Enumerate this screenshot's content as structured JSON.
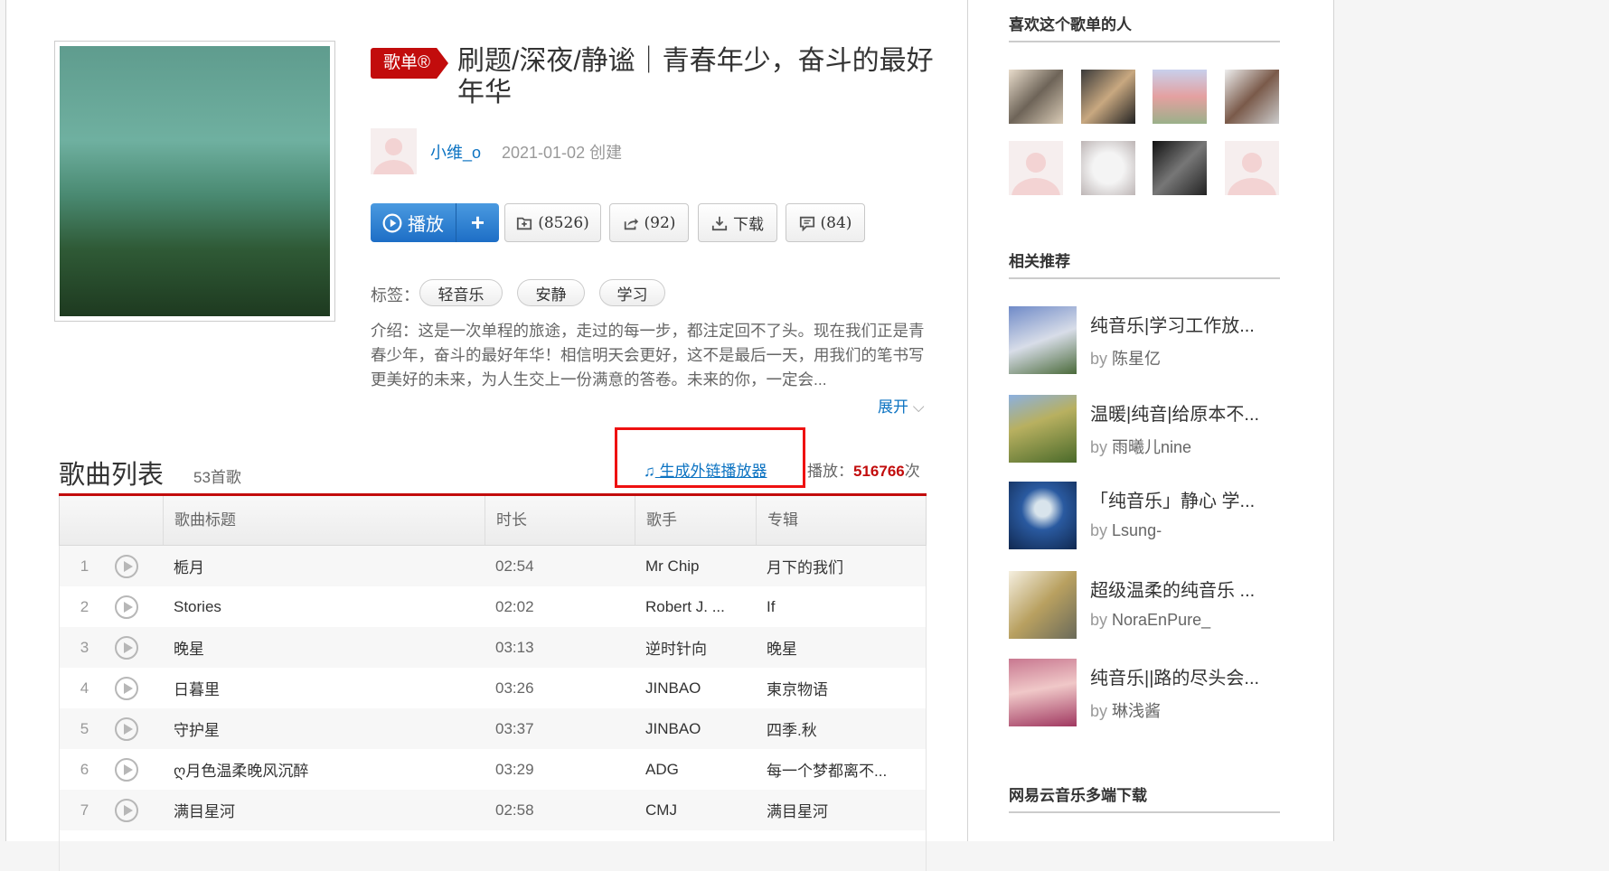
{
  "playlist": {
    "badge": "歌单®",
    "title": "刷题/深夜/静谧｜青春年少，奋斗的最好年华",
    "creator": "小维_o",
    "created": "2021-01-02 创建",
    "actions": {
      "play": "播放",
      "add": "+",
      "favorite": "(8526)",
      "share": "(92)",
      "download": "下载",
      "comment": "(84)"
    },
    "tags_label": "标签：",
    "tags": [
      "轻音乐",
      "安静",
      "学习"
    ],
    "intro": "介绍：这是一次单程的旅途，走过的每一步，都注定回不了头。现在我们正是青春少年，奋斗的最好年华！相信明天会更好，这不是最后一天，用我们的笔书写更美好的未来，为人生交上一份满意的答卷。未来的你，一定会...",
    "expand": "展开"
  },
  "songlist": {
    "title": "歌曲列表",
    "count": "53首歌",
    "outlink": "生成外链播放器",
    "plays_label": "播放：",
    "plays": "516766",
    "plays_unit": "次",
    "headers": [
      "",
      "歌曲标题",
      "时长",
      "歌手",
      "专辑"
    ],
    "rows": [
      {
        "i": "1",
        "title": "栀月",
        "dur": "02:54",
        "artist": "Mr Chip",
        "album": "月下的我们"
      },
      {
        "i": "2",
        "title": "Stories",
        "dur": "02:02",
        "artist": "Robert J. ...",
        "album": "If"
      },
      {
        "i": "3",
        "title": "晚星",
        "dur": "03:13",
        "artist": "逆时针向",
        "album": "晚星"
      },
      {
        "i": "4",
        "title": "日暮里",
        "dur": "03:26",
        "artist": "JINBAO",
        "album": "東京物语"
      },
      {
        "i": "5",
        "title": "守护星",
        "dur": "03:37",
        "artist": "JINBAO",
        "album": "四季.秋"
      },
      {
        "i": "6",
        "title": "ღ月色温柔晚风沉醉",
        "dur": "03:29",
        "artist": "ADG",
        "album": "每一个梦都离不..."
      },
      {
        "i": "7",
        "title": "满目星河",
        "dur": "02:58",
        "artist": "CMJ",
        "album": "满目星河"
      }
    ]
  },
  "sidebar": {
    "fans_title": "喜欢这个歌单的人",
    "related_title": "相关推荐",
    "download_title": "网易云音乐多端下载",
    "related": [
      {
        "title": "纯音乐|学习工作放...",
        "by": "by",
        "author": "陈星亿"
      },
      {
        "title": "温暖|纯音|给原本不...",
        "by": "by",
        "author": "雨曦儿nine"
      },
      {
        "title": "「纯音乐」静心 学...",
        "by": "by",
        "author": "Lsung-"
      },
      {
        "title": "超级温柔的纯音乐 ...",
        "by": "by",
        "author": "NoraEnPure_"
      },
      {
        "title": "纯音乐||路的尽头会...",
        "by": "by",
        "author": "琳浅酱"
      }
    ]
  },
  "colors": {
    "brand_red": "#c20c0c",
    "link_blue": "#0c73c2",
    "play_blue": "#1d6ec6"
  }
}
